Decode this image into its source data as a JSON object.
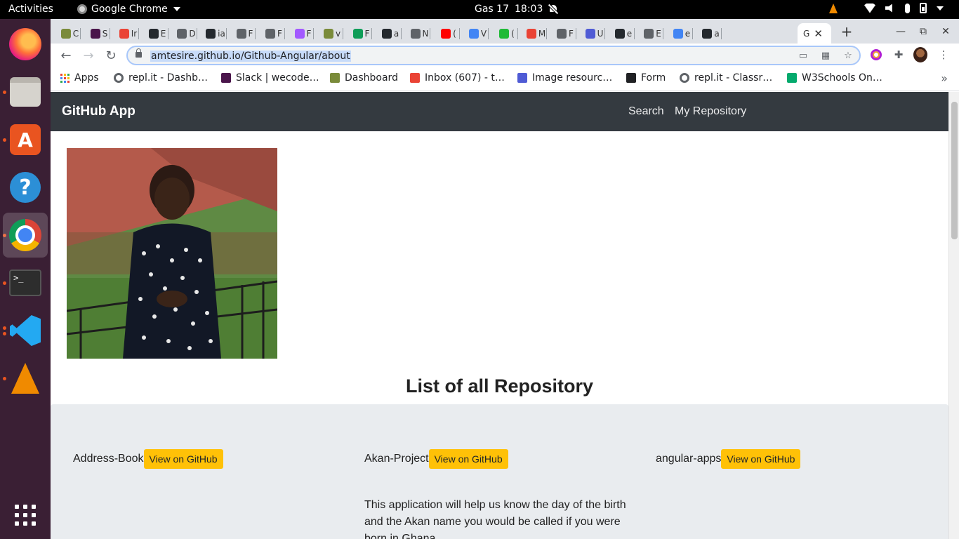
{
  "system": {
    "activities": "Activities",
    "app_name": "Google Chrome",
    "clock_day": "Gas 17",
    "clock_time": "18:03"
  },
  "tabs": [
    {
      "letter": "C",
      "color": "#7a8b3a"
    },
    {
      "letter": "S",
      "color": "#4a154b"
    },
    {
      "letter": "Ir",
      "color": "#ea4335"
    },
    {
      "letter": "E",
      "color": "#24292e"
    },
    {
      "letter": "D",
      "color": "#5f6368"
    },
    {
      "letter": "ia",
      "color": "#24292e"
    },
    {
      "letter": "F",
      "color": "#5f6368"
    },
    {
      "letter": "F",
      "color": "#5f6368"
    },
    {
      "letter": "F",
      "color": "#a259ff"
    },
    {
      "letter": "v",
      "color": "#7a8b3a"
    },
    {
      "letter": "F",
      "color": "#0f9d58"
    },
    {
      "letter": "a",
      "color": "#24292e"
    },
    {
      "letter": "N",
      "color": "#5f6368"
    },
    {
      "letter": "(",
      "color": "#ff0000"
    },
    {
      "letter": "V",
      "color": "#4285f4"
    },
    {
      "letter": "(",
      "color": "#1fba36"
    },
    {
      "letter": "M",
      "color": "#ea4335"
    },
    {
      "letter": "F",
      "color": "#5f6368"
    },
    {
      "letter": "U",
      "color": "#4f5bd5"
    },
    {
      "letter": "e",
      "color": "#24292e"
    },
    {
      "letter": "E",
      "color": "#5f6368"
    },
    {
      "letter": "e",
      "color": "#4285f4"
    },
    {
      "letter": "a",
      "color": "#24292e"
    }
  ],
  "active_tab": {
    "letter": "G"
  },
  "address_bar": {
    "url": "amtesire.github.io/Github-Angular/about"
  },
  "bookmarks": [
    {
      "label": "Apps",
      "icon": "apps-grid-icon"
    },
    {
      "label": "repl.it - Dashb…",
      "icon": "replit-icon",
      "color": "#5f6368"
    },
    {
      "label": "Slack | wecode…",
      "icon": "slack-icon",
      "color": "#4a154b"
    },
    {
      "label": "Dashboard",
      "icon": "moringa-icon",
      "color": "#7a8b3a"
    },
    {
      "label": "Inbox (607) - t…",
      "icon": "gmail-icon",
      "color": "#ea4335"
    },
    {
      "label": "Image resourc…",
      "icon": "docs-icon",
      "color": "#4f5bd5"
    },
    {
      "label": "Form",
      "icon": "codepen-icon",
      "color": "#202124"
    },
    {
      "label": "repl.it - Classr…",
      "icon": "replit-icon",
      "color": "#5f6368"
    },
    {
      "label": "W3Schools On…",
      "icon": "w3schools-icon",
      "color": "#04aa6d"
    }
  ],
  "page": {
    "brand": "GitHub App",
    "nav": {
      "search": "Search",
      "my_repository": "My Repository"
    },
    "heading": "List of all Repository",
    "button_label": "View on GitHub",
    "repos": [
      {
        "name": "Address-Book",
        "description": ""
      },
      {
        "name": "Akan-Project",
        "description": "This application will help us know the day of the birth and the Akan name you would be called if you were born in Ghana"
      },
      {
        "name": "angular-apps",
        "description": ""
      }
    ]
  },
  "colors": {
    "navbar": "#343a40",
    "button": "#ffc107",
    "section_bg": "#e9ecef",
    "dock": "#3a1f34",
    "accent": "#e95420"
  }
}
